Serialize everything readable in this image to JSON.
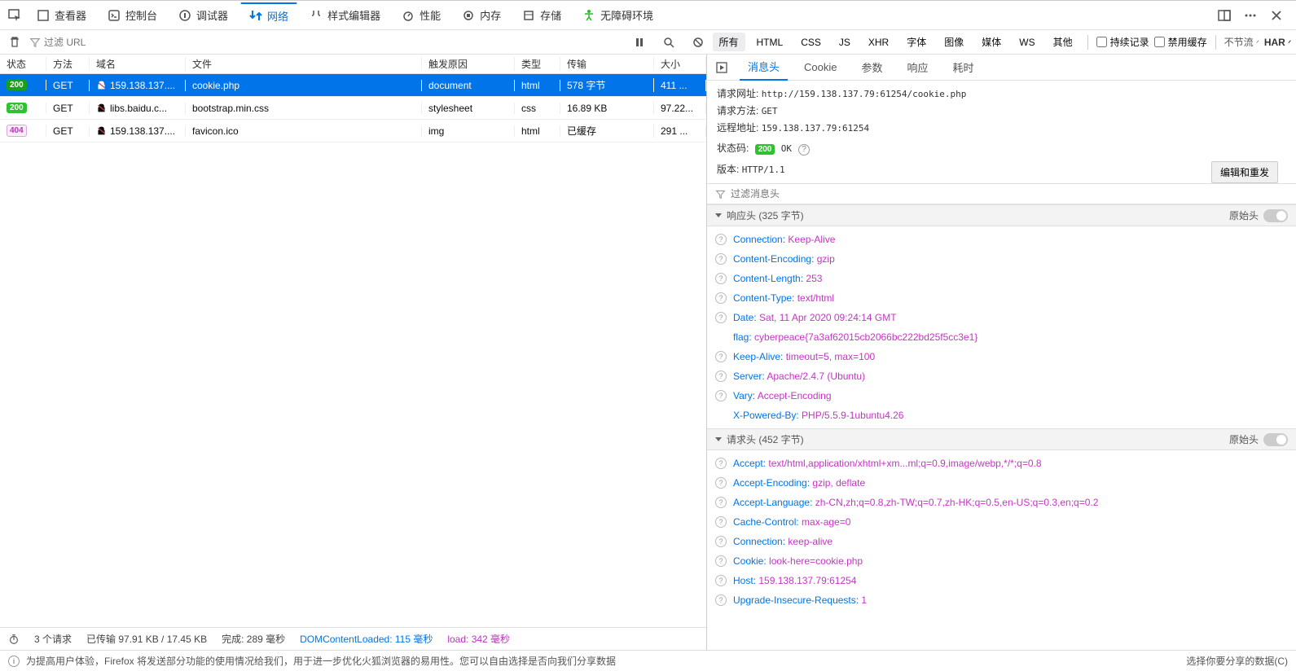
{
  "toolbar": {
    "inspector": "查看器",
    "console": "控制台",
    "debugger": "调试器",
    "network": "网络",
    "style": "样式编辑器",
    "perf": "性能",
    "memory": "内存",
    "storage": "存储",
    "a11y": "无障碍环境"
  },
  "filter": {
    "placeholder": "过滤 URL",
    "types": {
      "all": "所有",
      "html": "HTML",
      "css": "CSS",
      "js": "JS",
      "xhr": "XHR",
      "font": "字体",
      "img": "图像",
      "media": "媒体",
      "ws": "WS",
      "other": "其他"
    },
    "persist": "持续记录",
    "disableCache": "禁用缓存",
    "throttle": "不节流",
    "har": "HAR"
  },
  "cols": {
    "status": "状态",
    "method": "方法",
    "domain": "域名",
    "file": "文件",
    "cause": "触发原因",
    "type": "类型",
    "transfer": "传输",
    "size": "大小"
  },
  "rows": [
    {
      "status": "200",
      "s404": false,
      "method": "GET",
      "lock": "white",
      "domain": "159.138.137....",
      "file": "cookie.php",
      "cause": "document",
      "type": "html",
      "transfer": "578 字节",
      "size": "411 ..."
    },
    {
      "status": "200",
      "s404": false,
      "method": "GET",
      "lock": "green",
      "domain": "libs.baidu.c...",
      "file": "bootstrap.min.css",
      "cause": "stylesheet",
      "type": "css",
      "transfer": "16.89 KB",
      "size": "97.22..."
    },
    {
      "status": "404",
      "s404": true,
      "method": "GET",
      "lock": "gray",
      "domain": "159.138.137....",
      "file": "favicon.ico",
      "cause": "img",
      "type": "html",
      "transfer": "已缓存",
      "size": "291 ..."
    }
  ],
  "footer": {
    "reqs": "3 个请求",
    "xfer": "已传输 97.91 KB / 17.45 KB",
    "finish": "完成:  289 毫秒",
    "dcl": "DOMContentLoaded: 115 毫秒",
    "load": "load: 342 毫秒"
  },
  "rtabs": {
    "headers": "消息头",
    "cookies": "Cookie",
    "params": "参数",
    "response": "响应",
    "timing": "耗时"
  },
  "summary": {
    "url_k": "请求网址:",
    "url_v": "http://159.138.137.79:61254/cookie.php",
    "method_k": "请求方法:",
    "method_v": "GET",
    "remote_k": "远程地址:",
    "remote_v": "159.138.137.79:61254",
    "status_k": "状态码:",
    "status_v": "200",
    "status_t": "OK",
    "version_k": "版本:",
    "version_v": "HTTP/1.1",
    "edit": "编辑和重发"
  },
  "filterHdr": "过滤消息头",
  "sections": {
    "resp": "响应头 (325 字节)",
    "req": "请求头 (452 字节)",
    "raw": "原始头"
  },
  "respHdrs": [
    {
      "q": true,
      "name": "Connection:",
      "val": "Keep-Alive"
    },
    {
      "q": true,
      "name": "Content-Encoding:",
      "val": "gzip"
    },
    {
      "q": true,
      "name": "Content-Length:",
      "val": "253"
    },
    {
      "q": true,
      "name": "Content-Type:",
      "val": "text/html"
    },
    {
      "q": true,
      "name": "Date:",
      "val": "Sat, 11 Apr 2020 09:24:14 GMT"
    },
    {
      "q": false,
      "name": "flag:",
      "val": "cyberpeace{7a3af62015cb2066bc222bd25f5cc3e1}"
    },
    {
      "q": true,
      "name": "Keep-Alive:",
      "val": "timeout=5, max=100"
    },
    {
      "q": true,
      "name": "Server:",
      "val": "Apache/2.4.7 (Ubuntu)"
    },
    {
      "q": true,
      "name": "Vary:",
      "val": "Accept-Encoding"
    },
    {
      "q": false,
      "name": "X-Powered-By:",
      "val": "PHP/5.5.9-1ubuntu4.26"
    }
  ],
  "reqHdrs": [
    {
      "q": true,
      "name": "Accept:",
      "val": "text/html,application/xhtml+xm...ml;q=0.9,image/webp,*/*;q=0.8"
    },
    {
      "q": true,
      "name": "Accept-Encoding:",
      "val": "gzip, deflate"
    },
    {
      "q": true,
      "name": "Accept-Language:",
      "val": "zh-CN,zh;q=0.8,zh-TW;q=0.7,zh-HK;q=0.5,en-US;q=0.3,en;q=0.2"
    },
    {
      "q": true,
      "name": "Cache-Control:",
      "val": "max-age=0"
    },
    {
      "q": true,
      "name": "Connection:",
      "val": "keep-alive"
    },
    {
      "q": true,
      "name": "Cookie:",
      "val": "look-here=cookie.php"
    },
    {
      "q": true,
      "name": "Host:",
      "val": "159.138.137.79:61254"
    },
    {
      "q": true,
      "name": "Upgrade-Insecure-Requests:",
      "val": "1"
    }
  ],
  "notice": "为提高用户体验，Firefox 将发送部分功能的使用情况给我们，用于进一步优化火狐浏览器的易用性。您可以自由选择是否向我们分享数据",
  "notice_right": "选择你要分享的数据(C)"
}
